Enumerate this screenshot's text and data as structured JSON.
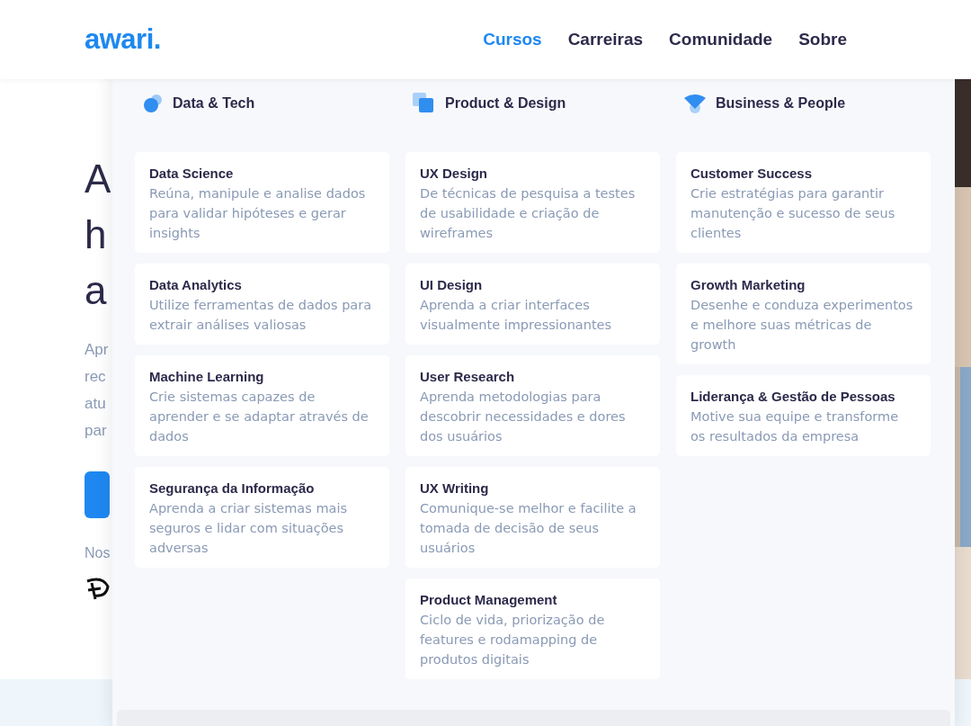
{
  "header": {
    "logo": "awari.",
    "nav": [
      {
        "label": "Cursos",
        "selected": true
      },
      {
        "label": "Carreiras",
        "selected": false
      },
      {
        "label": "Comunidade",
        "selected": false
      },
      {
        "label": "Sobre",
        "selected": false
      }
    ]
  },
  "hero": {
    "title_lines": [
      "A",
      "h",
      "a"
    ],
    "text_lines": [
      "Apr",
      "rec",
      "atu",
      "par"
    ],
    "partners_label": "Nos"
  },
  "dropdown": {
    "columns": [
      {
        "kind": "dot",
        "title": "Data & Tech",
        "courses": [
          {
            "title": "Data Science",
            "description": "Reúna, manipule e analise dados para validar hipóteses e gerar insights"
          },
          {
            "title": "Data Analytics",
            "description": "Utilize ferramentas de dados para extrair análises valiosas"
          },
          {
            "title": "Machine Learning",
            "description": "Crie sistemas capazes de aprender e se adaptar através de dados"
          },
          {
            "title": "Segurança da Informação",
            "description": "Aprenda a criar sistemas mais seguros e lidar com situações adversas"
          }
        ]
      },
      {
        "kind": "squares",
        "title": "Product & Design",
        "courses": [
          {
            "title": "UX Design",
            "description": "De técnicas de pesquisa a testes de usabilidade e criação de wireframes"
          },
          {
            "title": "UI Design",
            "description": "Aprenda a criar interfaces visualmente impressionantes"
          },
          {
            "title": "User Research",
            "description": "Aprenda metodologias para descobrir necessidades e dores dos usuários"
          },
          {
            "title": "UX Writing",
            "description": "Comunique-se melhor e facilite a tomada de decisão de seus usuários"
          },
          {
            "title": "Product Management",
            "description": "Ciclo de vida, priorização de features e rodamapping de produtos digitais"
          }
        ]
      },
      {
        "kind": "wedge",
        "title": "Business & People",
        "courses": [
          {
            "title": "Customer Success",
            "description": "Crie estratégias para garantir manutenção e sucesso de seus clientes"
          },
          {
            "title": "Growth Marketing",
            "description": "Desenhe e conduza experimentos e melhore suas métricas de growth"
          },
          {
            "title": "Liderança & Gestão de Pessoas",
            "description": "Motive sua equipe e transforme os resultados da empresa"
          }
        ]
      }
    ]
  }
}
